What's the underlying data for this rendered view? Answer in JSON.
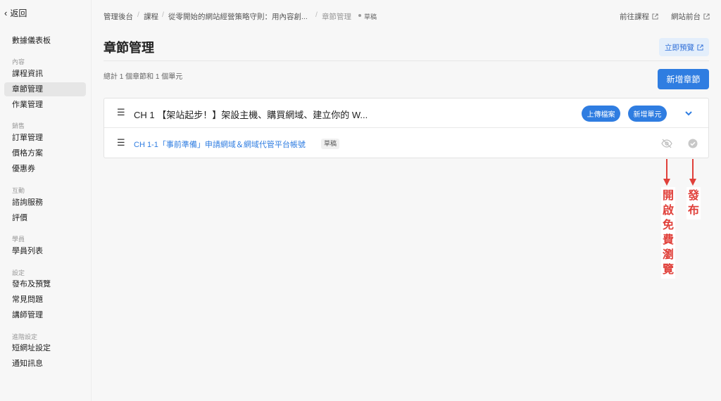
{
  "sidebar": {
    "back_label": "返回",
    "items": [
      {
        "label": "數據儀表板"
      },
      {
        "section": "內容"
      },
      {
        "label": "課程資訊"
      },
      {
        "label": "章節管理",
        "active": true
      },
      {
        "label": "作業管理"
      },
      {
        "section": "銷售"
      },
      {
        "label": "訂單管理"
      },
      {
        "label": "價格方案"
      },
      {
        "label": "優惠券"
      },
      {
        "section": "互動"
      },
      {
        "label": "諮詢服務"
      },
      {
        "label": "評價"
      },
      {
        "section": "學員"
      },
      {
        "label": "學員列表"
      },
      {
        "section": "設定"
      },
      {
        "label": "發布及預覽"
      },
      {
        "label": "常見問題"
      },
      {
        "label": "講師管理"
      },
      {
        "section": "進階設定"
      },
      {
        "label": "短網址設定"
      },
      {
        "label": "通知訊息"
      }
    ]
  },
  "breadcrumb": {
    "items": [
      "管理後台",
      "課程",
      "從零開始的網站經營策略守則：用內容創...",
      "章節管理"
    ],
    "status": "草稿"
  },
  "topbar": {
    "go_course": "前往課程",
    "site_front": "網站前台"
  },
  "page": {
    "title": "章節管理",
    "preview_button": "立即預覽",
    "summary": "總計 1 個章節和 1 個單元",
    "add_chapter_button": "新增章節"
  },
  "chapter": {
    "title": "CH 1 【架站起步！】架設主機、購買網域、建立你的 W...",
    "upload_button": "上傳檔案",
    "add_unit_button": "新增單元",
    "unit": {
      "title": "CH 1-1「事前準備」申請網域＆網域代管平台帳號",
      "badge": "草稿"
    }
  },
  "annotations": {
    "free_preview": "開啟免費瀏覽",
    "publish": "發布",
    "color": "#e0403a"
  },
  "colors": {
    "accent": "#2f7de1",
    "preview_bg": "#e3eefb"
  }
}
